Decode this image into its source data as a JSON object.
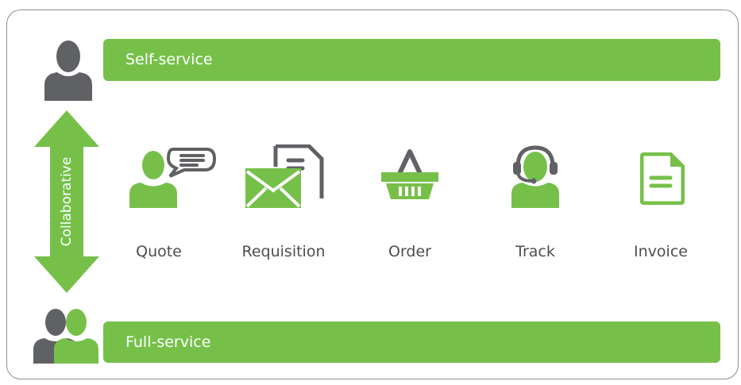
{
  "colors": {
    "green": "#76c04a",
    "gray": "#606164",
    "border": "#8f8f8f",
    "text": "#4d4d4d"
  },
  "self_service": {
    "label": "Self-service",
    "icon": "person-icon"
  },
  "full_service": {
    "label": "Full-service",
    "icon": "two-people-icon"
  },
  "axis": {
    "label": "Collaborative",
    "icon": "double-arrow-icon"
  },
  "steps": [
    {
      "label": "Quote",
      "icon": "person-speech-bubble-icon"
    },
    {
      "label": "Requisition",
      "icon": "envelope-document-icon"
    },
    {
      "label": "Order",
      "icon": "shopping-basket-icon"
    },
    {
      "label": "Track",
      "icon": "headset-agent-icon"
    },
    {
      "label": "Invoice",
      "icon": "document-icon"
    }
  ]
}
